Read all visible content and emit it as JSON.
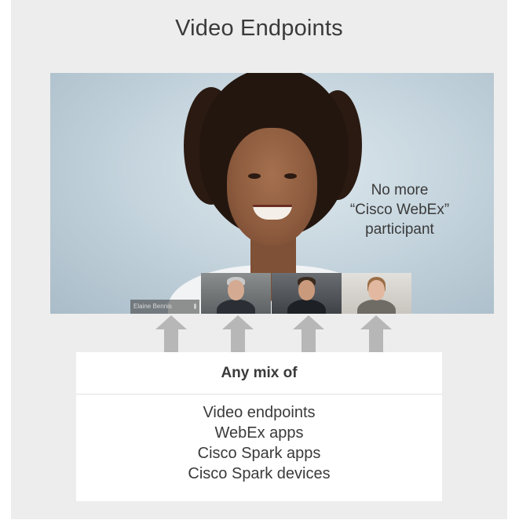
{
  "title": "Video Endpoints",
  "video": {
    "caption_lines": [
      "No more",
      "“Cisco WebEx”",
      "participant"
    ],
    "name_label": "Elaine Bennis"
  },
  "box": {
    "heading": "Any mix of",
    "items": [
      "Video endpoints",
      "WebEx apps",
      "Cisco Spark apps",
      "Cisco Spark devices"
    ]
  },
  "colors": {
    "panel": "#ededed",
    "arrow": "#b7b7b7",
    "text": "#3a3a3a"
  }
}
